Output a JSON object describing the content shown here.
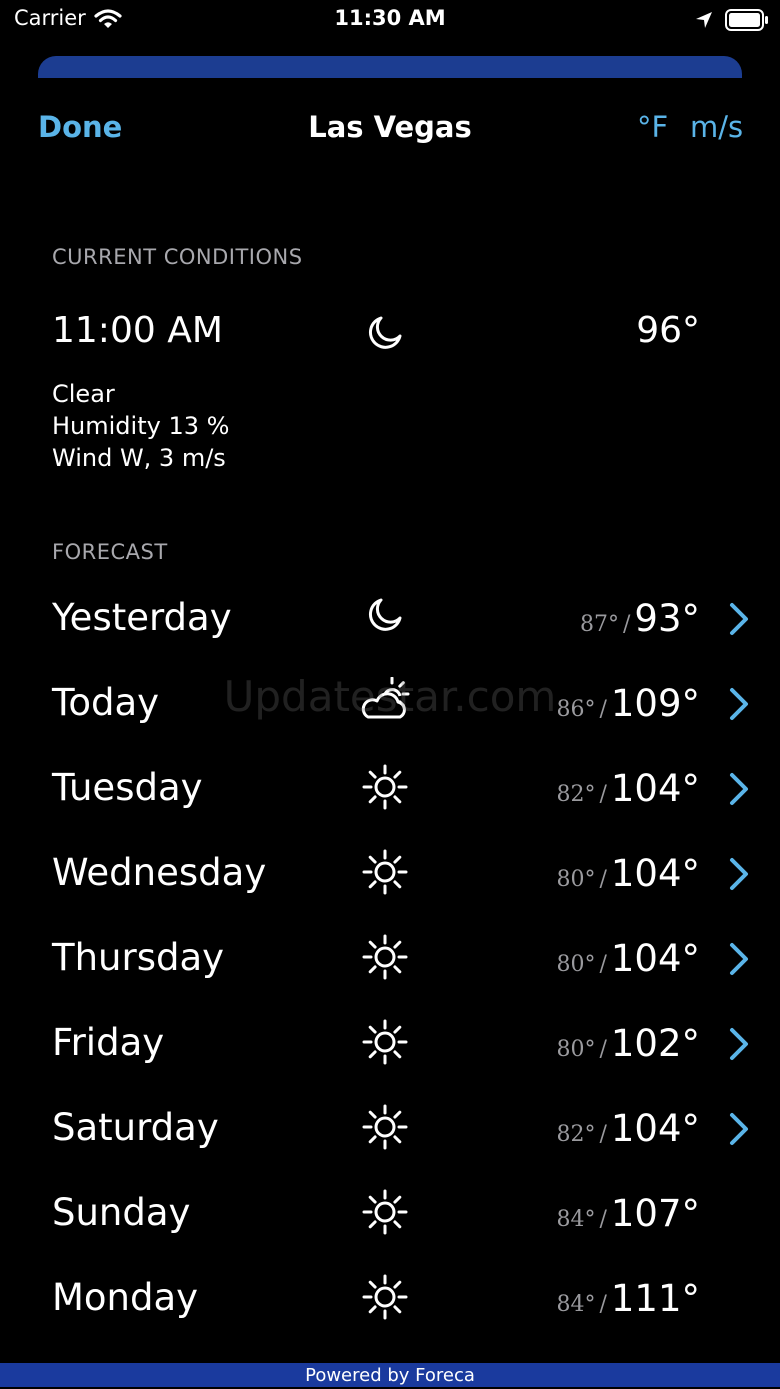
{
  "status": {
    "carrier": "Carrier",
    "time": "11:30 AM"
  },
  "nav": {
    "done": "Done",
    "title": "Las Vegas",
    "unit_temp": "°F",
    "unit_wind": "m/s"
  },
  "current": {
    "header": "CURRENT CONDITIONS",
    "time": "11:00 AM",
    "icon": "moon-icon",
    "temp": "96°",
    "condition": "Clear",
    "humidity": "Humidity 13 %",
    "wind": "Wind W, 3 m/s"
  },
  "forecast": {
    "header": "FORECAST",
    "days": [
      {
        "day": "Yesterday",
        "icon": "moon-icon",
        "low": "87°",
        "high": "93°",
        "chevron": true
      },
      {
        "day": "Today",
        "icon": "partly-sunny-icon",
        "low": "86°",
        "high": "109°",
        "chevron": true
      },
      {
        "day": "Tuesday",
        "icon": "sun-icon",
        "low": "82°",
        "high": "104°",
        "chevron": true
      },
      {
        "day": "Wednesday",
        "icon": "sun-icon",
        "low": "80°",
        "high": "104°",
        "chevron": true
      },
      {
        "day": "Thursday",
        "icon": "sun-icon",
        "low": "80°",
        "high": "104°",
        "chevron": true
      },
      {
        "day": "Friday",
        "icon": "sun-icon",
        "low": "80°",
        "high": "102°",
        "chevron": true
      },
      {
        "day": "Saturday",
        "icon": "sun-icon",
        "low": "82°",
        "high": "104°",
        "chevron": true
      },
      {
        "day": "Sunday",
        "icon": "sun-icon",
        "low": "84°",
        "high": "107°",
        "chevron": false
      },
      {
        "day": "Monday",
        "icon": "sun-icon",
        "low": "84°",
        "high": "111°",
        "chevron": false
      }
    ],
    "separator": "/"
  },
  "watermark": "Updatestar.com",
  "footer": "Powered by Foreca",
  "colors": {
    "accent": "#5ab4e8",
    "sheet_bar": "#1c3d91",
    "footer_bar": "#1a3a9e"
  }
}
